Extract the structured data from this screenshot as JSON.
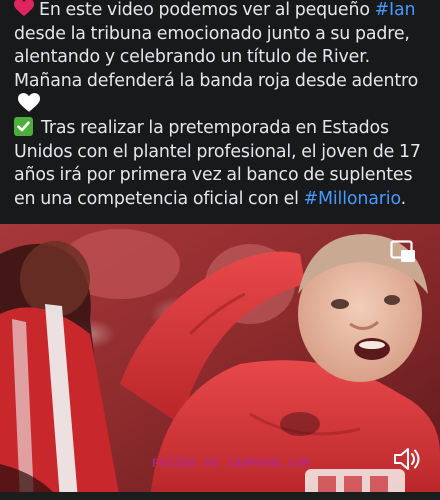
{
  "post": {
    "paragraph1": {
      "text_a": "En este video podemos ver al pequeño ",
      "hashtag": "#Ian",
      "text_b": " desde la tribuna emocionado junto a su padre, alentando y celebrando un título de River. Mañana defenderá la banda roja desde adentro"
    },
    "paragraph2": {
      "text_a": "Tras realizar la pretemporada en Estados Unidos con el plantel profesional, el joven de 17 años irá por primera vez al banco de suplentes en una competencia oficial con el ",
      "hashtag": "#Millonario",
      "text_b": "."
    },
    "emojis": [
      "red-heart",
      "white-heart",
      "check-mark-button"
    ]
  },
  "video": {
    "watermark": "PASIÓN DE CAMPEÓN.COM",
    "controls": [
      "picture-in-picture-icon",
      "volume-icon"
    ]
  },
  "colors": {
    "background": "#18191a",
    "text": "#e4e6eb",
    "hashtag": "#4599ff",
    "heart": "#e0245e",
    "check": "#4caf3c"
  }
}
